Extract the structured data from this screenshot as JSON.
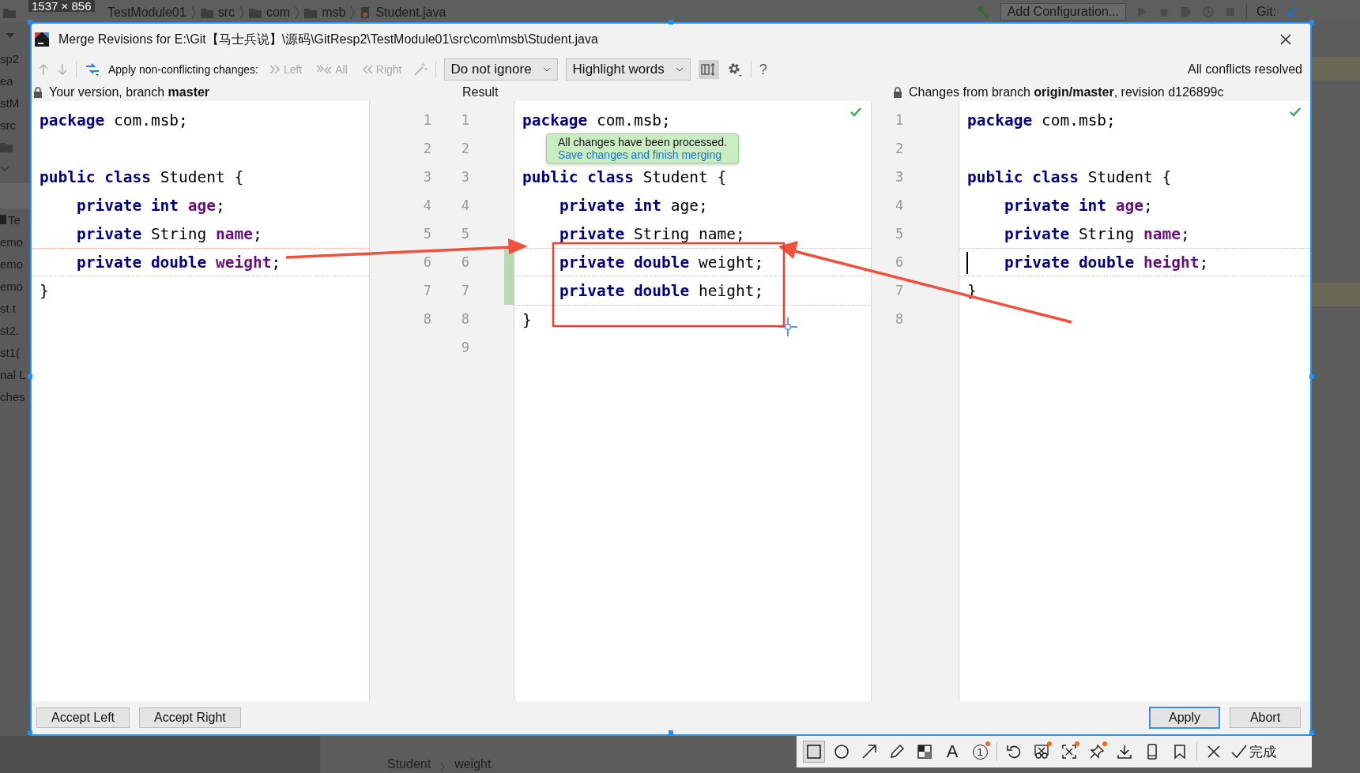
{
  "ide": {
    "size_label": "1537 × 856",
    "breadcrumbs": [
      "TestModule01",
      "src",
      "com",
      "msb",
      "Student.java"
    ],
    "run_config": "Add Configuration...",
    "git_label": "Git:",
    "project_tree": [
      {
        "kind": "text",
        "text": "sp2"
      },
      {
        "kind": "text",
        "text": "ea"
      },
      {
        "kind": "text",
        "text": "stM"
      },
      {
        "kind": "text",
        "text": "src"
      },
      {
        "kind": "folder"
      },
      {
        "kind": "expander"
      },
      {
        "kind": "highlight"
      },
      {
        "kind": "file",
        "text": "Te"
      },
      {
        "kind": "text",
        "text": "emo"
      },
      {
        "kind": "text",
        "text": "emo"
      },
      {
        "kind": "text",
        "text": "emo"
      },
      {
        "kind": "text",
        "text": "st.t"
      },
      {
        "kind": "text",
        "text": "st2."
      },
      {
        "kind": "text",
        "text": "st1("
      },
      {
        "kind": "text",
        "text": "nal L"
      },
      {
        "kind": "text",
        "text": "ches"
      }
    ],
    "editor_breadcrumbs": [
      "Student",
      "weight"
    ]
  },
  "dialog": {
    "title": "Merge Revisions for E:\\Git【马士兵说】\\源码\\GitResp2\\TestModule01\\src\\com\\msb\\Student.java",
    "toolbar": {
      "apply_label": "Apply non-conflicting changes:",
      "apply_buttons": [
        {
          "kind": "left",
          "label": "Left",
          "disabled": true
        },
        {
          "kind": "all",
          "label": "All",
          "disabled": true
        },
        {
          "kind": "right",
          "label": "Right",
          "disabled": true
        }
      ],
      "ignore": "Do not ignore",
      "highlight": "Highlight words",
      "side_by_side": true,
      "help": "?",
      "status": "All conflicts resolved"
    },
    "left_header": "Your version, branch **master**",
    "result_header": "Result",
    "right_header": "Changes from branch **origin/master**, revision d126899c",
    "left_lines": [
      {
        "changed": false,
        "tokens": [
          {
            "kind": "keyword",
            "text": "package"
          },
          {
            "kind": "plain",
            "text": " com.msb;"
          }
        ]
      },
      {
        "changed": false
      },
      {
        "changed": false,
        "tokens": [
          {
            "kind": "keyword",
            "text": "public class"
          },
          {
            "kind": "plain",
            "text": " Student {"
          }
        ]
      },
      {
        "changed": false,
        "tokens": [
          {
            "kind": "keyword",
            "text": "    private int"
          },
          {
            "kind": "field",
            "text": " age"
          },
          {
            "kind": "plain",
            "text": ";"
          }
        ]
      },
      {
        "changed": false,
        "tokens": [
          {
            "kind": "keyword",
            "text": "    private"
          },
          {
            "kind": "plain",
            "text": " String"
          },
          {
            "kind": "field",
            "text": " name"
          },
          {
            "kind": "plain",
            "text": ";"
          }
        ]
      },
      {
        "changed": true,
        "tokens": [
          {
            "kind": "keyword",
            "text": "    private double"
          },
          {
            "kind": "field",
            "text": " weight"
          },
          {
            "kind": "plain",
            "text": ";"
          }
        ]
      },
      {
        "changed": false,
        "tokens": [
          {
            "kind": "plain",
            "text": "}"
          }
        ]
      }
    ],
    "result_lines": [
      {
        "changed": false,
        "tokens": [
          {
            "kind": "keyword",
            "text": "package"
          },
          {
            "kind": "plain",
            "text": " com.msb;"
          }
        ]
      },
      {
        "changed": false
      },
      {
        "changed": false,
        "tokens": [
          {
            "kind": "keyword",
            "text": "public class"
          },
          {
            "kind": "plain",
            "text": " Student {"
          }
        ]
      },
      {
        "changed": false,
        "tokens": [
          {
            "kind": "keyword",
            "text": "    private int"
          },
          {
            "kind": "plain",
            "text": " age;"
          }
        ]
      },
      {
        "changed": false,
        "tokens": [
          {
            "kind": "keyword",
            "text": "    private"
          },
          {
            "kind": "plain",
            "text": " String name;"
          }
        ]
      },
      {
        "changed": true,
        "tokens": [
          {
            "kind": "keyword",
            "text": "    private double"
          },
          {
            "kind": "plain",
            "text": " weight;"
          }
        ]
      },
      {
        "changed": true,
        "tokens": [
          {
            "kind": "keyword",
            "text": "    private double"
          },
          {
            "kind": "plain",
            "text": " height;"
          }
        ]
      },
      {
        "changed": false,
        "tokens": [
          {
            "kind": "plain",
            "text": "}"
          }
        ]
      }
    ],
    "right_lines": [
      {
        "changed": false,
        "caret": false,
        "tokens": [
          {
            "kind": "keyword",
            "text": "package"
          },
          {
            "kind": "plain",
            "text": " com.msb;"
          }
        ]
      },
      {
        "changed": false,
        "caret": false
      },
      {
        "changed": false,
        "caret": false,
        "tokens": [
          {
            "kind": "keyword",
            "text": "public class"
          },
          {
            "kind": "plain",
            "text": " Student {"
          }
        ]
      },
      {
        "changed": false,
        "caret": false,
        "tokens": [
          {
            "kind": "keyword",
            "text": "    private int"
          },
          {
            "kind": "field",
            "text": " age"
          },
          {
            "kind": "plain",
            "text": ";"
          }
        ]
      },
      {
        "changed": false,
        "caret": false,
        "tokens": [
          {
            "kind": "keyword",
            "text": "    private"
          },
          {
            "kind": "plain",
            "text": " String"
          },
          {
            "kind": "field",
            "text": " name"
          },
          {
            "kind": "plain",
            "text": ";"
          }
        ]
      },
      {
        "changed": true,
        "caret": true,
        "tokens": [
          {
            "kind": "keyword",
            "text": "    private double"
          },
          {
            "kind": "field",
            "text": " height"
          },
          {
            "kind": "plain",
            "text": ";"
          }
        ]
      },
      {
        "changed": false,
        "caret": false,
        "tokens": [
          {
            "kind": "plain",
            "text": "}"
          }
        ]
      }
    ],
    "left_numbers": [
      "1",
      "2",
      "3",
      "4",
      "5",
      "6",
      "7",
      "8"
    ],
    "result_numbers": [
      "1",
      "2",
      "3",
      "4",
      "5",
      "6",
      "7",
      "8",
      "9"
    ],
    "right_numbers": [
      "1",
      "2",
      "3",
      "4",
      "5",
      "6",
      "7",
      "8"
    ],
    "tooltip": {
      "message": "All changes have been processed.",
      "link": "Save changes and finish merging"
    },
    "accept_buttons": [
      "Accept Left",
      "Accept Right"
    ],
    "buttons": [
      {
        "label": "Apply",
        "default": true
      },
      {
        "label": "Abort",
        "default": false
      }
    ]
  },
  "capture_toolbar": {
    "tools": [
      {
        "kind": "rectangle",
        "selected": true,
        "dot": false
      },
      {
        "kind": "ellipse",
        "selected": false,
        "dot": false
      },
      {
        "kind": "arrow",
        "selected": false,
        "dot": false
      },
      {
        "kind": "pencil",
        "selected": false,
        "dot": false
      },
      {
        "kind": "mosaic",
        "selected": false,
        "dot": false
      },
      {
        "kind": "text",
        "glyph": "A",
        "selected": false,
        "dot": false
      },
      {
        "kind": "number",
        "glyph": "1",
        "selected": false,
        "dot": true
      },
      {
        "kind": "sep"
      },
      {
        "kind": "undo",
        "selected": false,
        "dot": false
      },
      {
        "kind": "scissors",
        "selected": false,
        "dot": true
      },
      {
        "kind": "capture",
        "selected": false,
        "dot": true
      },
      {
        "kind": "pin",
        "selected": false,
        "dot": true
      },
      {
        "kind": "download",
        "selected": false,
        "dot": false
      },
      {
        "kind": "phone",
        "selected": false,
        "dot": false
      },
      {
        "kind": "bookmark",
        "selected": false,
        "dot": false
      },
      {
        "kind": "sep"
      },
      {
        "kind": "close",
        "selected": false,
        "dot": false
      }
    ],
    "done": "完成"
  }
}
